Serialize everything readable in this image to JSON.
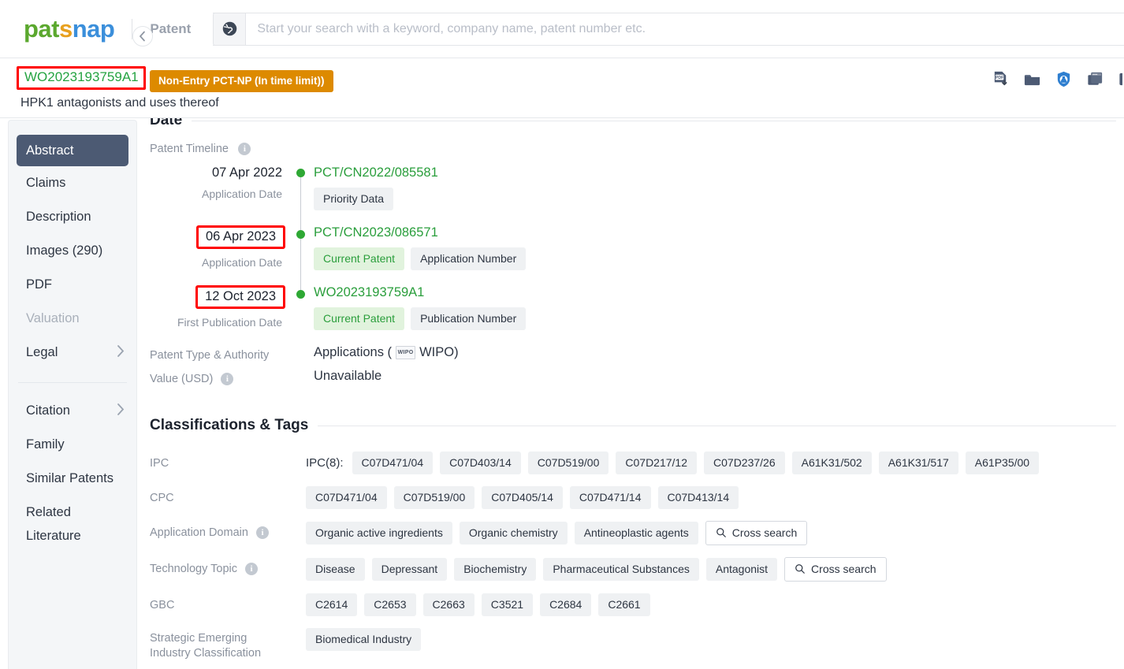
{
  "header": {
    "logo": {
      "part1": "pat",
      "part2": "s",
      "part3": "nap"
    },
    "mode_label": "Patent",
    "search": {
      "placeholder": "Start your search with a keyword, company name, patent number etc.",
      "value": ""
    },
    "globe_icon": "globe-icon"
  },
  "patent": {
    "number": "WO2023193759A1",
    "status_badge": "Non-Entry PCT-NP (In time limit))",
    "title": "HPK1 antagonists and uses thereof",
    "toolbar": [
      {
        "name": "pdf-download-icon"
      },
      {
        "name": "folder-icon"
      },
      {
        "name": "chemistry-flask-icon"
      },
      {
        "name": "copy-window-icon"
      },
      {
        "name": "partial-icon"
      }
    ]
  },
  "sidebar": {
    "collapse_label": "‹",
    "items": [
      {
        "label": "Abstract",
        "active": true,
        "chevron": false,
        "disabled": false
      },
      {
        "label": "Claims",
        "active": false,
        "chevron": false,
        "disabled": false
      },
      {
        "label": "Description",
        "active": false,
        "chevron": false,
        "disabled": false
      },
      {
        "label": "Images (290)",
        "active": false,
        "chevron": false,
        "disabled": false
      },
      {
        "label": "PDF",
        "active": false,
        "chevron": false,
        "disabled": false
      },
      {
        "label": "Valuation",
        "active": false,
        "chevron": false,
        "disabled": true
      },
      {
        "label": "Legal",
        "active": false,
        "chevron": true,
        "disabled": false
      }
    ],
    "items2": [
      {
        "label": "Citation",
        "chevron": true
      },
      {
        "label": "Family",
        "chevron": false
      },
      {
        "label": "Similar Patents",
        "chevron": false
      }
    ],
    "related_line1": "Related",
    "related_line2": "Literature"
  },
  "sections": {
    "date": {
      "heading": "Date",
      "timeline_label": "Patent Timeline",
      "events": [
        {
          "date": "07 Apr 2022",
          "date_boxed": false,
          "sublabel": "Application Date",
          "reference": "PCT/CN2022/085581",
          "tags": [
            {
              "text": "Priority Data",
              "style": "grey"
            }
          ]
        },
        {
          "date": "06 Apr 2023",
          "date_boxed": true,
          "sublabel": "Application Date",
          "reference": "PCT/CN2023/086571",
          "tags": [
            {
              "text": "Current Patent",
              "style": "green"
            },
            {
              "text": "Application Number",
              "style": "grey"
            }
          ]
        },
        {
          "date": "12 Oct 2023",
          "date_boxed": true,
          "sublabel": "First Publication Date",
          "reference": "WO2023193759A1",
          "tags": [
            {
              "text": "Current Patent",
              "style": "green"
            },
            {
              "text": "Publication Number",
              "style": "grey"
            }
          ]
        }
      ],
      "patent_type": {
        "label": "Patent Type & Authority",
        "prefix": "Applications (",
        "authority_badge": "WIPO",
        "authority": "WIPO",
        "suffix": ")"
      },
      "value": {
        "label": "Value (USD)",
        "text": "Unavailable"
      }
    },
    "classifications": {
      "heading": "Classifications & Tags",
      "ipc": {
        "label": "IPC",
        "prefix": "IPC(8):",
        "tags": [
          "C07D471/04",
          "C07D403/14",
          "C07D519/00",
          "C07D217/12",
          "C07D237/26",
          "A61K31/502",
          "A61K31/517",
          "A61P35/00"
        ]
      },
      "cpc": {
        "label": "CPC",
        "tags": [
          "C07D471/04",
          "C07D519/00",
          "C07D405/14",
          "C07D471/14",
          "C07D413/14"
        ]
      },
      "application_domain": {
        "label": "Application Domain",
        "tags": [
          "Organic active ingredients",
          "Organic chemistry",
          "Antineoplastic agents"
        ],
        "cross_search": "Cross search"
      },
      "technology_topic": {
        "label": "Technology Topic",
        "tags": [
          "Disease",
          "Depressant",
          "Biochemistry",
          "Pharmaceutical Substances",
          "Antagonist"
        ],
        "cross_search": "Cross search"
      },
      "gbc": {
        "label": "GBC",
        "tags": [
          "C2614",
          "C2653",
          "C2663",
          "C3521",
          "C2684",
          "C2661"
        ]
      },
      "seic": {
        "label_line1": "Strategic Emerging",
        "label_line2": "Industry Classification",
        "tags": [
          "Biomedical Industry"
        ]
      }
    }
  },
  "colors": {
    "accent_green": "#2A9E3C",
    "badge_orange": "#DD8A00",
    "highlight_red": "#FF0000",
    "sidebar_active": "#4C5A73",
    "tag_grey": "#EFF1F3",
    "tag_green": "#E1F3DD"
  }
}
